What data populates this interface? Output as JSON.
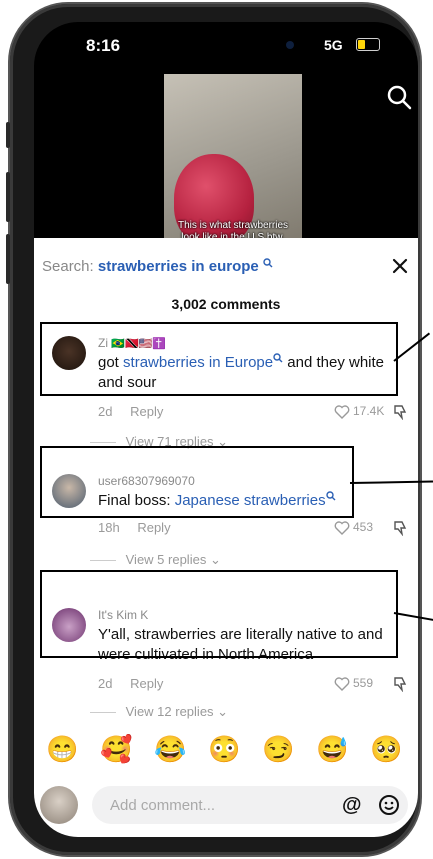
{
  "status": {
    "time": "8:16",
    "network": "5G"
  },
  "video": {
    "caption_line1": "This is what strawberries",
    "caption_line2": "look like in the U.S btw."
  },
  "search": {
    "prefix": "Search:",
    "query": "strawberries in europe"
  },
  "comments_count": "3,002 comments",
  "comments": [
    {
      "username": "Zi",
      "flags": "🇧🇷🇹🇹🇺🇸✝️",
      "text_before": "got ",
      "link": "strawberries in Europe",
      "text_after": " and they white and sour",
      "age": "2d",
      "reply": "Reply",
      "likes": "17.4K",
      "view_replies": "View 71 replies"
    },
    {
      "username": "user68307969070",
      "text_before": "Final boss: ",
      "link": "Japanese strawberries",
      "text_after": "",
      "age": "18h",
      "reply": "Reply",
      "likes": "453",
      "view_replies": "View 5 replies"
    },
    {
      "username": "It's Kim K",
      "text_before": "Y'all, strawberries are literally native to and were cultivated in North America",
      "link": "",
      "text_after": "",
      "age": "2d",
      "reply": "Reply",
      "likes": "559",
      "view_replies": "View 12 replies"
    }
  ],
  "emojis": [
    "😁",
    "🥰",
    "😂",
    "😳",
    "😏",
    "😅",
    "🥺"
  ],
  "input": {
    "placeholder": "Add comment...",
    "at": "@"
  },
  "colors": {
    "link": "#2a5fb4",
    "muted": "#9a9a9a",
    "highlight_border": "#000000"
  }
}
